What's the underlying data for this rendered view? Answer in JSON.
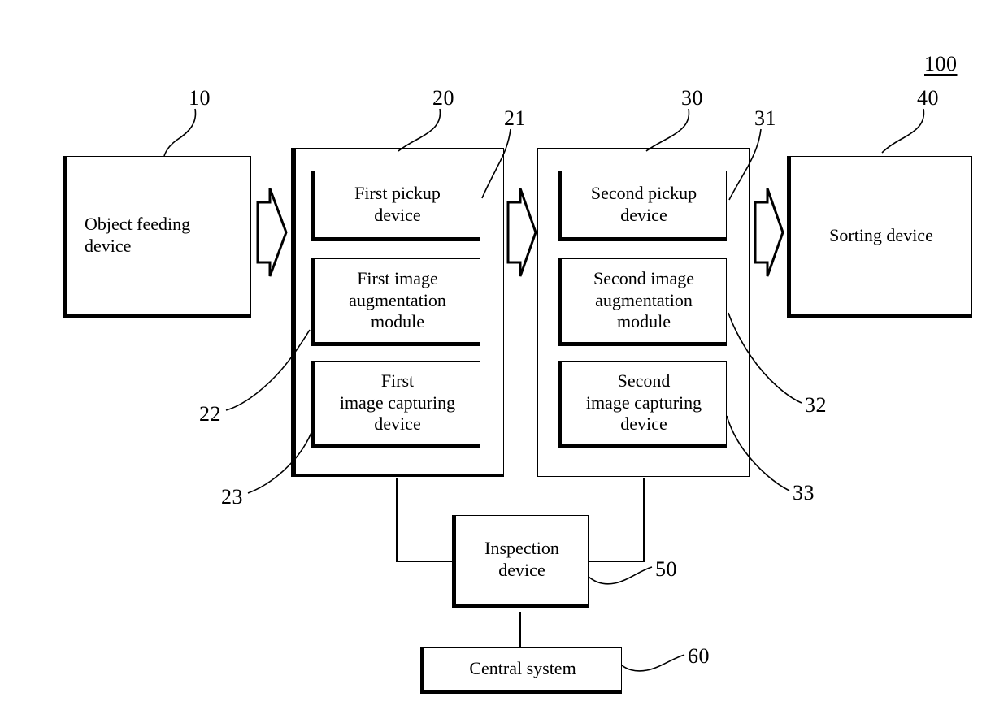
{
  "figure": {
    "system_label": "100",
    "blocks": {
      "object_feeding": "Object feeding\ndevice",
      "object_feeding_line1": "Object feeding",
      "object_feeding_line2": "device",
      "sorting": "Sorting device",
      "inspection_line1": "Inspection",
      "inspection_line2": "device",
      "central": "Central system",
      "first_pickup_line1": "First pickup",
      "first_pickup_line2": "device",
      "first_aug_line1": "First image",
      "first_aug_line2": "augmentation",
      "first_aug_line3": "module",
      "first_capture_line1": "First",
      "first_capture_line2": "image capturing",
      "first_capture_line3": "device",
      "second_pickup_line1": "Second pickup",
      "second_pickup_line2": "device",
      "second_aug_line1": "Second image",
      "second_aug_line2": "augmentation",
      "second_aug_line3": "module",
      "second_capture_line1": "Second",
      "second_capture_line2": "image capturing",
      "second_capture_line3": "device"
    },
    "reference_numerals": {
      "object_feeding": "10",
      "first_group": "20",
      "first_pickup": "21",
      "first_augmentation": "22",
      "first_capturing": "23",
      "second_group": "30",
      "second_pickup": "31",
      "second_augmentation": "32",
      "second_capturing": "33",
      "sorting": "40",
      "inspection": "50",
      "central": "60"
    },
    "colors": {
      "ink": "#000000",
      "paper": "#ffffff"
    }
  }
}
